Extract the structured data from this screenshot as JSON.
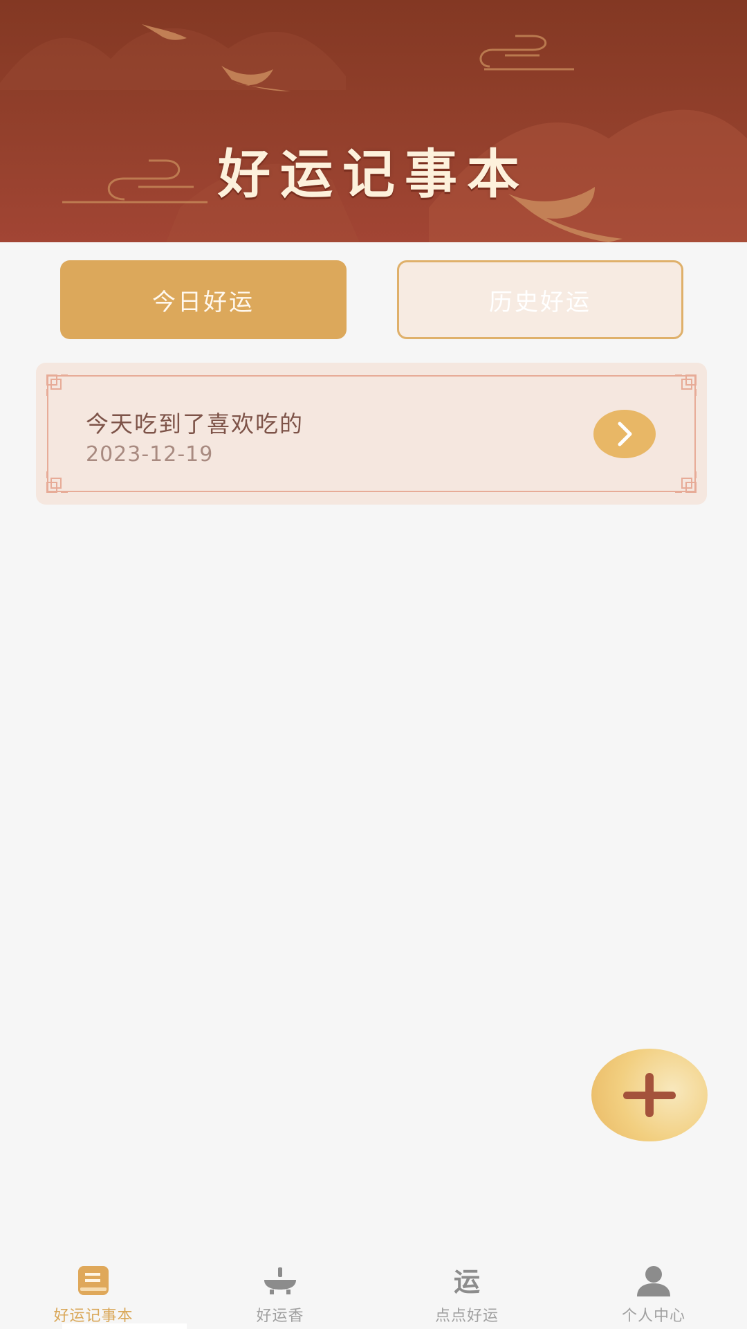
{
  "header": {
    "title": "好运记事本"
  },
  "tabs": [
    {
      "label": "今日好运",
      "active": true
    },
    {
      "label": "历史好运",
      "active": false
    }
  ],
  "records": [
    {
      "title": "今天吃到了喜欢吃的",
      "date": "2023-12-19"
    }
  ],
  "fab": {
    "icon": "plus-icon"
  },
  "nav": {
    "items": [
      {
        "label": "好运记事本",
        "icon": "notebook-icon",
        "active": true
      },
      {
        "label": "好运香",
        "icon": "incense-burner-icon",
        "active": false
      },
      {
        "label": "点点好运",
        "icon": "yun-character-icon",
        "icon_text": "运",
        "active": false
      },
      {
        "label": "个人中心",
        "icon": "user-icon",
        "active": false
      }
    ]
  },
  "colors": {
    "banner": "#93402c",
    "accent_gold": "#dca85b",
    "card_bg": "#f5e7df",
    "card_border": "#e7ab97",
    "fab_plus": "#a4523b"
  }
}
